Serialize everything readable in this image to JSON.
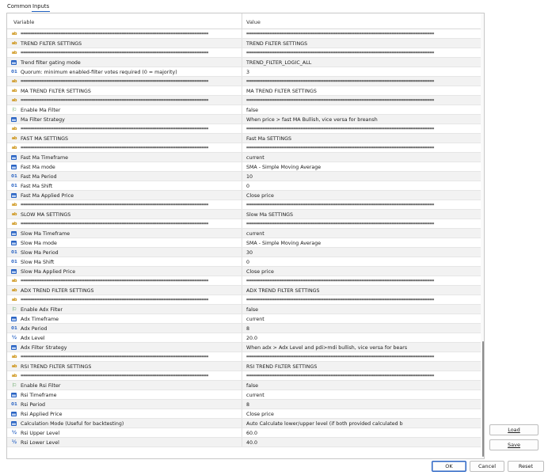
{
  "tabs": [
    "Common",
    "Inputs"
  ],
  "columns": {
    "variable": "Variable",
    "value": "Value"
  },
  "separator": "================================================================================",
  "rows": [
    {
      "icon": "ab",
      "var": "SEP",
      "val": "SEP"
    },
    {
      "icon": "ab",
      "var": "TREND FILTER SETTINGS",
      "val": "TREND FILTER SETTINGS"
    },
    {
      "icon": "ab",
      "var": "SEP",
      "val": "SEP"
    },
    {
      "icon": "enum",
      "var": "Trend filter gating mode",
      "val": "TREND_FILTER_LOGIC_ALL"
    },
    {
      "icon": "01",
      "var": "Quorum: minimum enabled-filter votes required (0 = majority)",
      "val": "3"
    },
    {
      "icon": "ab",
      "var": "SEP",
      "val": "SEP"
    },
    {
      "icon": "ab",
      "var": "MA TREND FILTER SETTINGS",
      "val": "MA TREND FILTER SETTINGS"
    },
    {
      "icon": "ab",
      "var": "SEP",
      "val": "SEP"
    },
    {
      "icon": "flag",
      "var": "Enable Ma Filter",
      "val": "false"
    },
    {
      "icon": "enum",
      "var": "Ma Filter Strategy",
      "val": "When price > fast MA Bullish, vice versa for breansh"
    },
    {
      "icon": "ab",
      "var": "SEP",
      "val": "SEP"
    },
    {
      "icon": "ab",
      "var": "FAST MA SETTINGS",
      "val": "Fast Ma SETTINGS"
    },
    {
      "icon": "ab",
      "var": "SEP",
      "val": "SEP"
    },
    {
      "icon": "enum",
      "var": "Fast Ma Timeframe",
      "val": "current"
    },
    {
      "icon": "enum",
      "var": "Fast Ma mode",
      "val": "SMA  - Simple Moving Average"
    },
    {
      "icon": "01",
      "var": "Fast Ma Period",
      "val": "10"
    },
    {
      "icon": "01",
      "var": "Fast Ma Shift",
      "val": "0"
    },
    {
      "icon": "enum",
      "var": "Fast Ma Applied Price",
      "val": "Close price"
    },
    {
      "icon": "ab",
      "var": "SEP",
      "val": "SEP"
    },
    {
      "icon": "ab",
      "var": "SLOW MA SETTINGS",
      "val": "Slow Ma SETTINGS"
    },
    {
      "icon": "ab",
      "var": "SEP",
      "val": "SEP"
    },
    {
      "icon": "enum",
      "var": "Slow Ma Timeframe",
      "val": "current"
    },
    {
      "icon": "enum",
      "var": "Slow Ma mode",
      "val": "SMA  - Simple Moving Average"
    },
    {
      "icon": "01",
      "var": "Slow Ma Period",
      "val": "30"
    },
    {
      "icon": "01",
      "var": "Slow Ma Shift",
      "val": "0"
    },
    {
      "icon": "enum",
      "var": "Slow Ma Applied Price",
      "val": "Close price"
    },
    {
      "icon": "ab",
      "var": "SEP",
      "val": "SEP"
    },
    {
      "icon": "ab",
      "var": "ADX TREND FILTER SETTINGS",
      "val": "ADX TREND FILTER SETTINGS"
    },
    {
      "icon": "ab",
      "var": "SEP",
      "val": "SEP"
    },
    {
      "icon": "flag",
      "var": "Enable Adx Filter",
      "val": "false"
    },
    {
      "icon": "enum",
      "var": "Adx Timeframe",
      "val": "current"
    },
    {
      "icon": "01",
      "var": "Adx Period",
      "val": "8"
    },
    {
      "icon": "v2",
      "var": "Adx Level",
      "val": "20.0"
    },
    {
      "icon": "enum",
      "var": "Adx Filter Strategy",
      "val": "When adx > Adx Level and pdi>mdi bullish, vice versa for bears"
    },
    {
      "icon": "ab",
      "var": "SEP",
      "val": "SEP"
    },
    {
      "icon": "ab",
      "var": "RSI TREND FILTER SETTINGS",
      "val": "RSI TREND FILTER SETTINGS"
    },
    {
      "icon": "ab",
      "var": "SEP",
      "val": "SEP"
    },
    {
      "icon": "flag",
      "var": "Enable Rsi Filter",
      "val": "false"
    },
    {
      "icon": "enum",
      "var": "Rsi Timeframe",
      "val": "current"
    },
    {
      "icon": "01",
      "var": "Rsi Period",
      "val": "8"
    },
    {
      "icon": "enum",
      "var": "Rsi Applied Price",
      "val": "Close price"
    },
    {
      "icon": "enum",
      "var": "Calculation Mode (Useful for backtesting)",
      "val": "Auto Calculate lower/upper level (if both provided calculated b"
    },
    {
      "icon": "v2",
      "var": "Rsi Upper Level",
      "val": "60.0"
    },
    {
      "icon": "v2",
      "var": "Rsi Lower Level",
      "val": "40.0"
    }
  ],
  "icons": {
    "ab": {
      "name": "string-type-icon",
      "glyph": "ab"
    },
    "01": {
      "name": "integer-type-icon",
      "glyph": "01"
    },
    "v2": {
      "name": "double-type-icon",
      "glyph": "½"
    },
    "enum": {
      "name": "enum-type-icon",
      "glyph": ""
    },
    "flag": {
      "name": "bool-flag-icon",
      "glyph": "⚐"
    }
  },
  "buttons": {
    "load": "Load",
    "save": "Save",
    "ok": "OK",
    "cancel": "Cancel",
    "reset": "Reset"
  },
  "colors": {
    "accent": "#2a64c4",
    "string_icon": "#c98a00",
    "bool_icon": "#2f8a2f",
    "row_alt": "#f2f2f2"
  }
}
